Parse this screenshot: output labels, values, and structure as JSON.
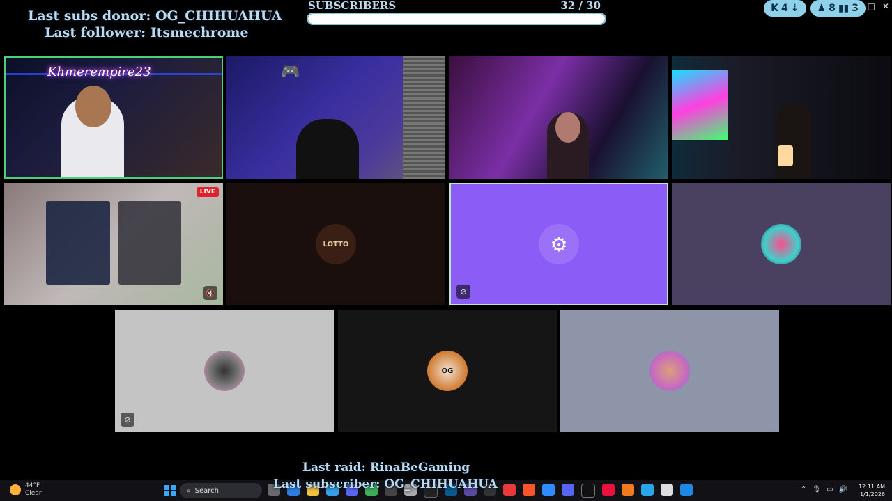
{
  "overlay": {
    "last_donor": "Last subs donor: OG_CHIHUAHUA",
    "last_follower": "Last follower: Itsmechrome",
    "last_raid": "Last raid: RinaBeGaming",
    "last_subscriber": "Last subscriber: OG_CHIHUAHUA"
  },
  "sub_goal": {
    "label": "SUBSCRIBERS",
    "count": "32  / 30",
    "progress_fraction": 1.0
  },
  "top_right": {
    "kick_stat": "4",
    "viewers": "8",
    "chart_stat": "3"
  },
  "window_controls": {
    "minimize": "—",
    "maximize": "□",
    "close": "✕"
  },
  "tiles": {
    "cam1_label": "Khmerempire23",
    "stream_live_badge": "LIVE",
    "lotto_avatar_text": "LOTTO",
    "og_avatar_text": "OG"
  },
  "taskbar": {
    "temperature": "44°F",
    "condition": "Clear",
    "search_label": "Search",
    "time": "12:11 AM",
    "date": "1/1/2026"
  },
  "colors": {
    "accent_text": "#bcd9ee",
    "purple_tile": "#8b5cf6",
    "slate_tile": "#4a4060",
    "grey_tile": "#c4c4c4",
    "bluegrey_tile": "#8e95a8"
  }
}
